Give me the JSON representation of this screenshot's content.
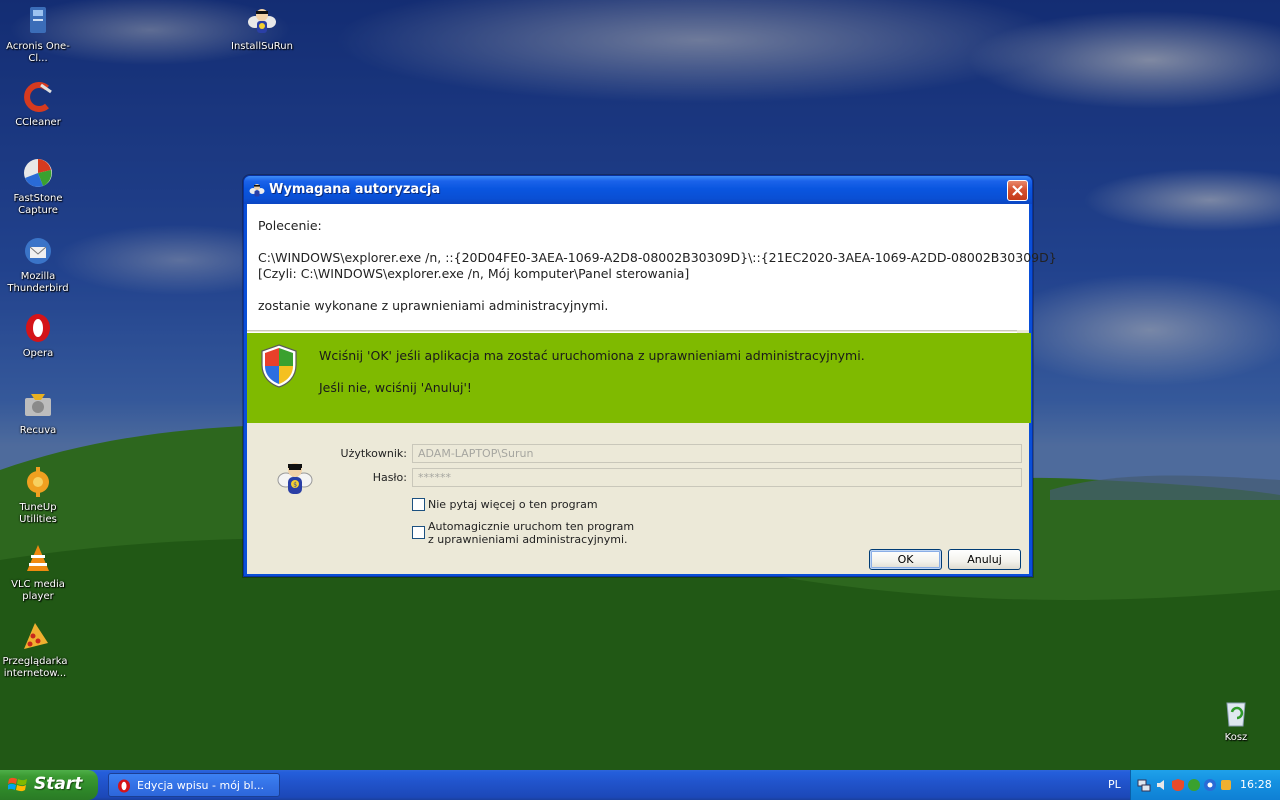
{
  "desktop": {
    "icons": [
      {
        "label": "Acronis One-Cl...",
        "icon": "acronis-icon"
      },
      {
        "label": "InstallSuRun",
        "icon": "installsurun-icon"
      },
      {
        "label": "CCleaner",
        "icon": "ccleaner-icon"
      },
      {
        "label": "FastStone Capture",
        "icon": "faststone-icon"
      },
      {
        "label": "Mozilla Thunderbird",
        "icon": "thunderbird-icon"
      },
      {
        "label": "Opera",
        "icon": "opera-icon"
      },
      {
        "label": "Recuva",
        "icon": "recuva-icon"
      },
      {
        "label": "TuneUp Utilities",
        "icon": "tuneup-icon"
      },
      {
        "label": "VLC media player",
        "icon": "vlc-icon"
      },
      {
        "label": "Przeglądarka internetow...",
        "icon": "pizza-browser-icon"
      },
      {
        "label": "Kosz",
        "icon": "recycle-bin-icon"
      }
    ]
  },
  "dialog": {
    "title": "Wymagana autoryzacja",
    "command_heading": "Polecenie:",
    "command_line": "C:\\WINDOWS\\explorer.exe /n, ::{20D04FE0-3AEA-1069-A2D8-08002B30309D}\\::{21EC2020-3AEA-1069-A2DD-08002B30309D}",
    "command_alias": "[Czyli: C:\\WINDOWS\\explorer.exe /n, Mój komputer\\Panel sterowania]",
    "command_note": "zostanie wykonane z uprawnieniami administracyjnymi.",
    "prompt_ok": "Wciśnij 'OK' jeśli aplikacja ma zostać uruchomiona z uprawnieniami administracyjnymi.",
    "prompt_cancel": "Jeśli nie, wciśnij 'Anuluj'!",
    "user_label": "Użytkownik:",
    "user_value": "ADAM-LAPTOP\\Surun",
    "password_label": "Hasło:",
    "password_value": "******",
    "checkbox_dont_ask": "Nie pytaj więcej o ten program",
    "checkbox_auto_line1": "Automagicznie uruchom ten program",
    "checkbox_auto_line2": "z uprawnieniami administracyjnymi.",
    "ok_button": "OK",
    "cancel_button": "Anuluj",
    "green_color": "#7fba00"
  },
  "taskbar": {
    "start_label": "Start",
    "task_label": "Edycja wpisu - mój bl...",
    "language": "PL",
    "clock": "16:28"
  }
}
